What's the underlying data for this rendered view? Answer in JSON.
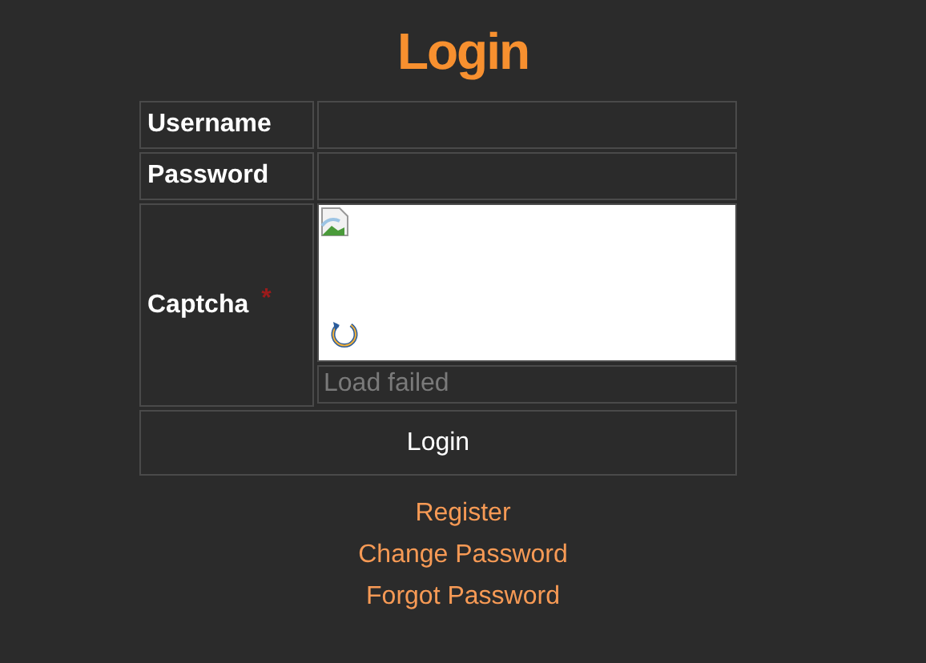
{
  "title": "Login",
  "fields": [
    {
      "label": "Username"
    },
    {
      "label": "Password"
    }
  ],
  "captcha": {
    "label": "Captcha",
    "required_mark": "*",
    "placeholder": "Load failed"
  },
  "submit": "Login",
  "links": [
    "Register",
    "Change Password",
    "Forgot Password"
  ]
}
